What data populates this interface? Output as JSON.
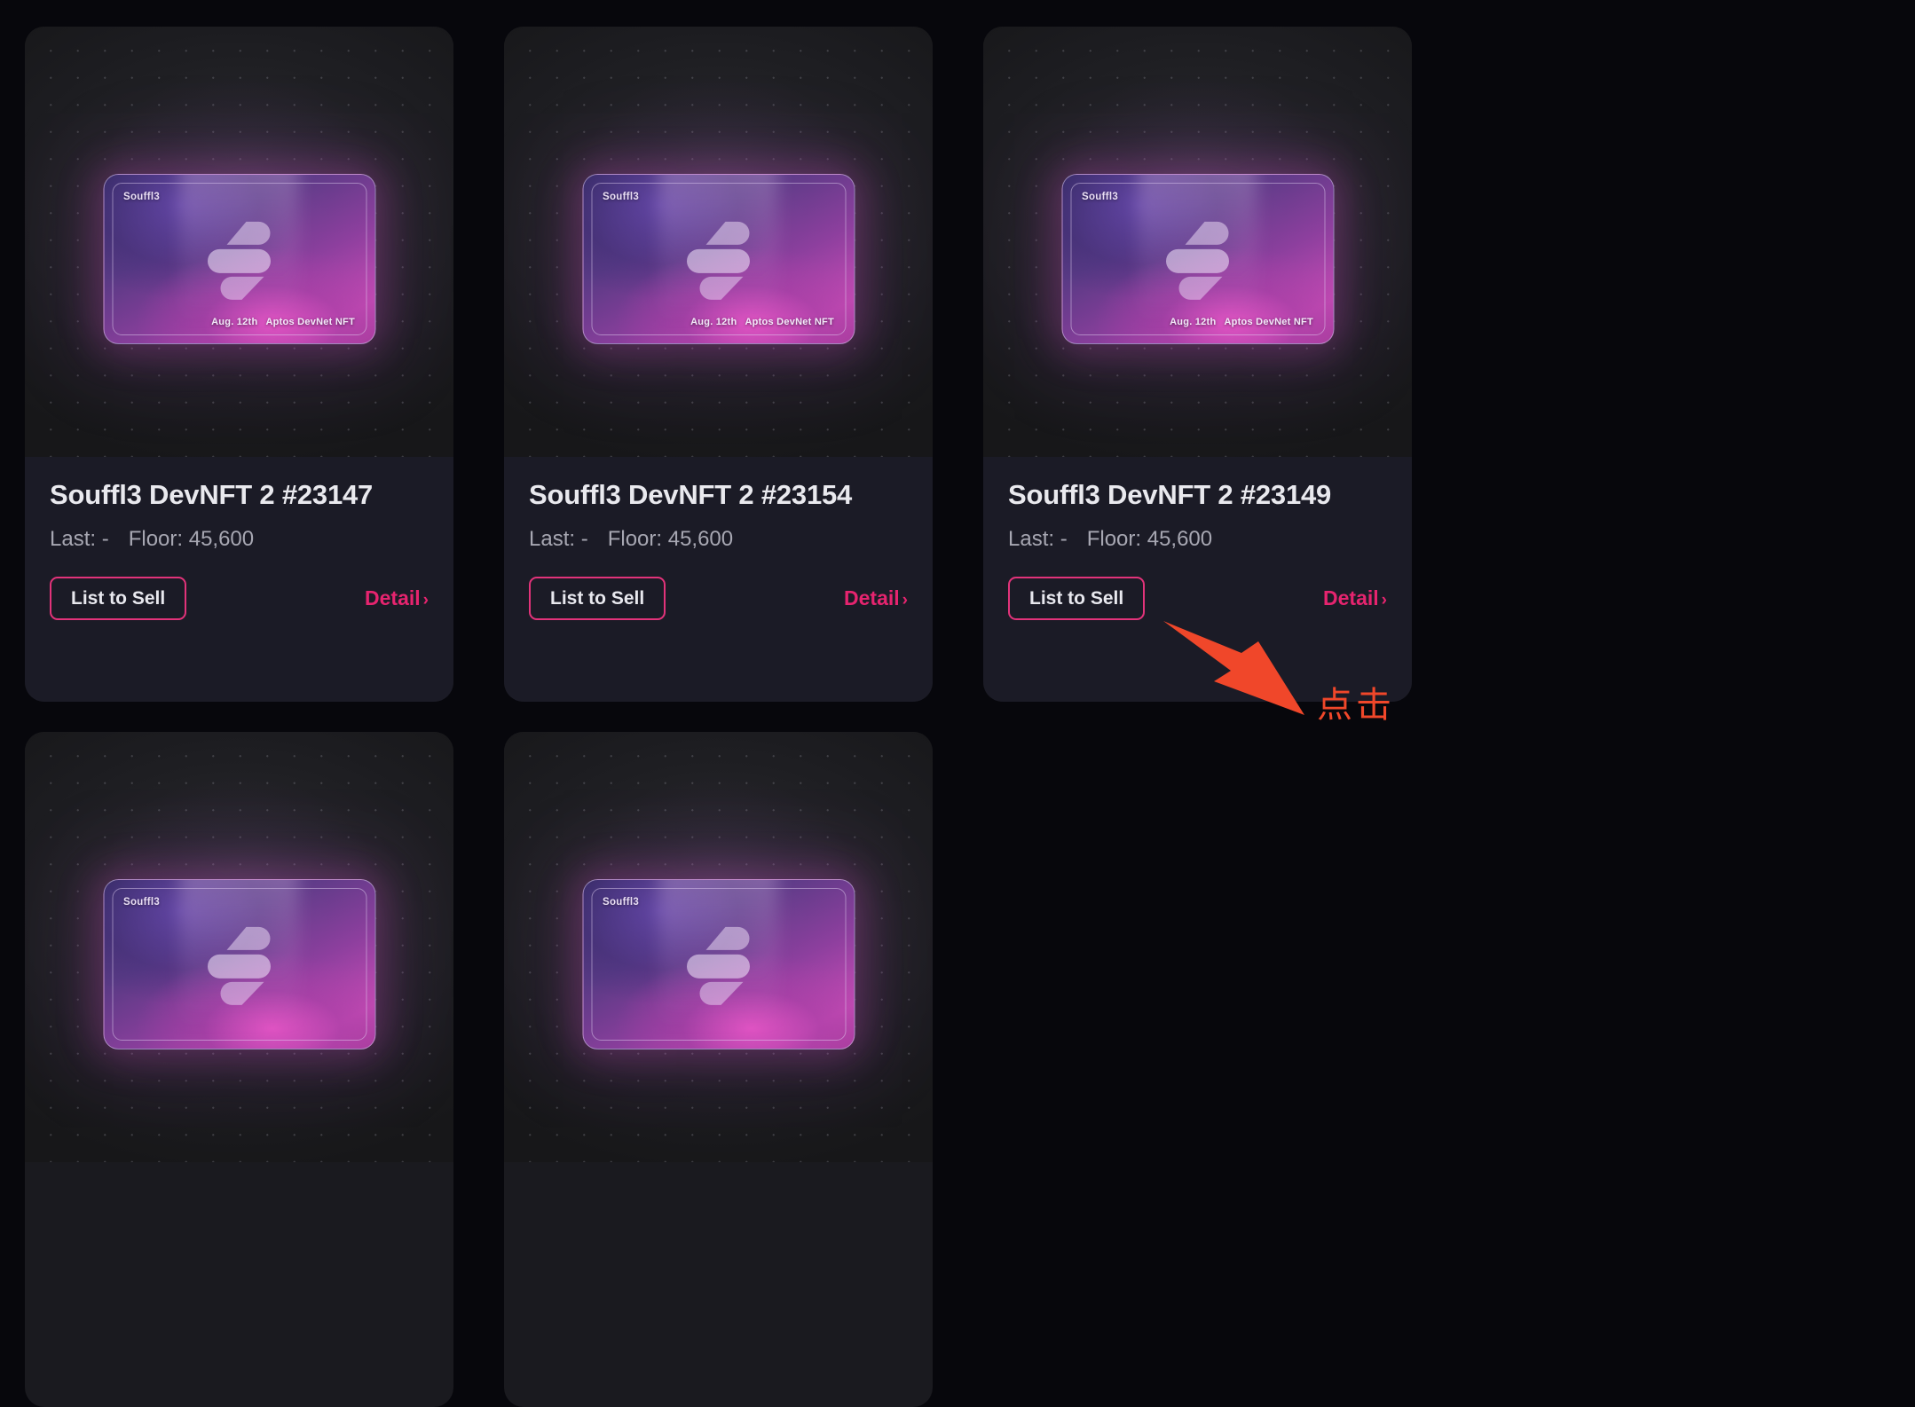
{
  "theme": {
    "page_background": "#07070c",
    "card_background": "#1b1b26",
    "accent_pink": "#e6246f",
    "button_border": "#e2337a",
    "title_color": "#e9e9ee",
    "stat_color": "#a7a7b2",
    "annotation_color": "#f0472a",
    "nft_gradient_from": "#3c2f66",
    "nft_gradient_to": "#c44bb4"
  },
  "nft_art": {
    "brand_label": "Souffl3",
    "footer_date": "Aug. 12th",
    "footer_label": "Aptos DevNet NFT",
    "logo_icon": "souffl3-logo-icon"
  },
  "labels": {
    "list_to_sell": "List to Sell",
    "detail": "Detail",
    "detail_chevron": "›",
    "last_prefix": "Last:",
    "floor_prefix": "Floor:"
  },
  "cards": [
    {
      "title": "Souffl3 DevNFT 2 #23147",
      "last": "Last: -",
      "floor": "Floor: 45,600",
      "list_button": "List to Sell",
      "detail": "Detail"
    },
    {
      "title": "Souffl3 DevNFT 2 #23154",
      "last": "Last: -",
      "floor": "Floor: 45,600",
      "list_button": "List to Sell",
      "detail": "Detail"
    },
    {
      "title": "Souffl3 DevNFT 2 #23149",
      "last": "Last: -",
      "floor": "Floor: 45,600",
      "list_button": "List to Sell",
      "detail": "Detail"
    }
  ],
  "annotation": {
    "text": "点击",
    "arrow_icon": "arrow-pointing-to-list-to-sell-button",
    "target": "List to Sell"
  }
}
